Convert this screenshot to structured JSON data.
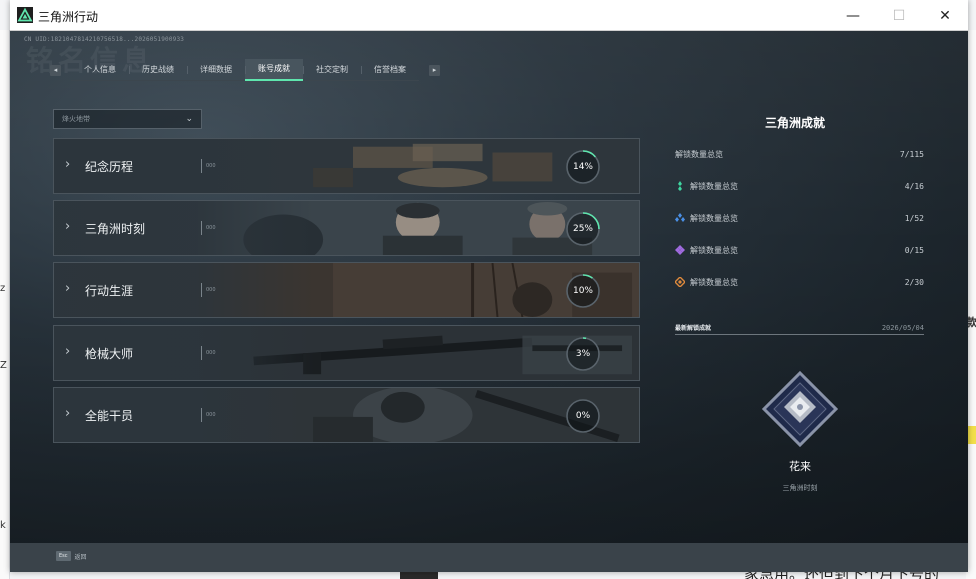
{
  "window": {
    "title": "三角洲行动",
    "controls": {
      "minimize": "—",
      "maximize": "☐",
      "close": "✕"
    }
  },
  "account": {
    "uid_line": "CN UID:1821047814210756518...2026051900933"
  },
  "ghost_heading": "铭名信息",
  "tabs": [
    {
      "label": "个人信息",
      "active": false
    },
    {
      "label": "历史战绩",
      "active": false
    },
    {
      "label": "详细数据",
      "active": false
    },
    {
      "label": "账号成就",
      "active": true
    },
    {
      "label": "社交定制",
      "active": false
    },
    {
      "label": "信誉档案",
      "active": false
    }
  ],
  "tab_nav": {
    "prev": "◂",
    "next": "▸"
  },
  "filter": {
    "value": "烽火地带"
  },
  "categories": [
    {
      "label": "纪念历程",
      "percent": 14,
      "percent_text": "14%",
      "tiny": "000"
    },
    {
      "label": "三角洲时刻",
      "percent": 25,
      "percent_text": "25%",
      "tiny": "000"
    },
    {
      "label": "行动生涯",
      "percent": 10,
      "percent_text": "10%",
      "tiny": "000"
    },
    {
      "label": "枪械大师",
      "percent": 3,
      "percent_text": "3%",
      "tiny": "000"
    },
    {
      "label": "全能干员",
      "percent": 0,
      "percent_text": "0%",
      "tiny": "000"
    }
  ],
  "panel": {
    "title": "三角洲成就",
    "total": {
      "label": "解锁数量总览",
      "value": "7/115"
    },
    "stats": [
      {
        "label": "解锁数量总览",
        "value": "4/16",
        "icon": "green-diamond-icon",
        "color": "#3fd6a0"
      },
      {
        "label": "解锁数量总览",
        "value": "1/52",
        "icon": "blue-cluster-icon",
        "color": "#4a8fe6"
      },
      {
        "label": "解锁数量总览",
        "value": "0/15",
        "icon": "purple-cluster-icon",
        "color": "#a06be0"
      },
      {
        "label": "解锁数量总览",
        "value": "2/30",
        "icon": "orange-target-icon",
        "color": "#e08a3c"
      }
    ],
    "recent": {
      "label": "最新解锁成就",
      "date": "2026/05/04",
      "badge_name": "花来",
      "badge_category": "三角洲时刻"
    }
  },
  "footer": {
    "key": "Esc",
    "label": "返回"
  },
  "colors": {
    "accent": "#5fe6ae",
    "progress_track": "#59636b",
    "progress_fill": "#5fe6ae"
  },
  "background_doc": {
    "fragments": [
      "我",
      "z",
      "Z",
      "k",
      "款"
    ],
    "bottom_line": "家急用。还但到下个月下号的"
  }
}
